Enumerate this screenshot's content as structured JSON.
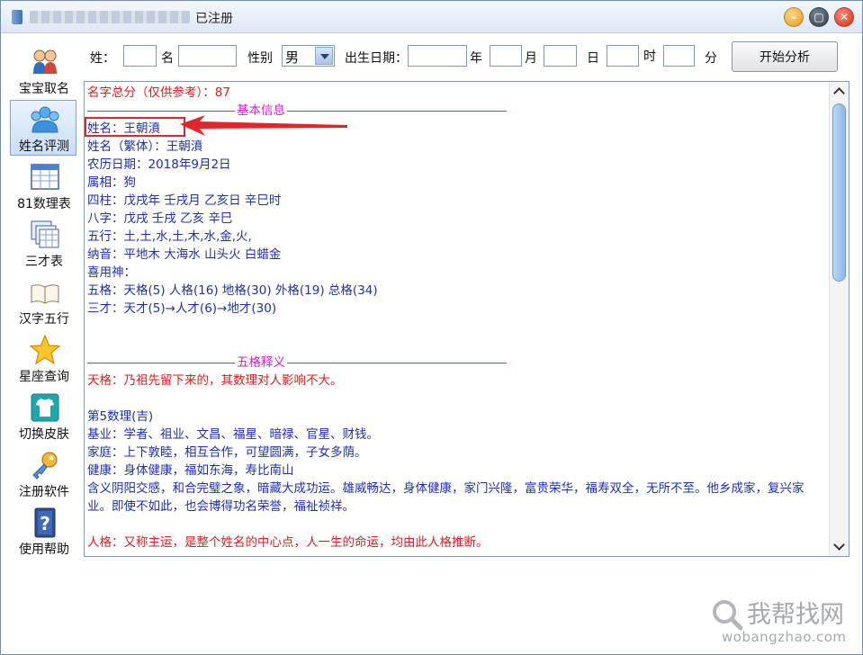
{
  "window": {
    "title": "已注册"
  },
  "sidebar": {
    "items": [
      {
        "label": "宝宝取名",
        "icon": "users-icon",
        "active": false
      },
      {
        "label": "姓名评测",
        "icon": "users-group-icon",
        "active": true
      },
      {
        "label": "81数理表",
        "icon": "table-icon",
        "active": false
      },
      {
        "label": "三才表",
        "icon": "table-stack-icon",
        "active": false
      },
      {
        "label": "汉字五行",
        "icon": "book-icon",
        "active": false
      },
      {
        "label": "星座查询",
        "icon": "star-icon",
        "active": false
      },
      {
        "label": "切换皮肤",
        "icon": "shirt-icon",
        "active": false
      },
      {
        "label": "注册软件",
        "icon": "key-icon",
        "active": false
      },
      {
        "label": "使用帮助",
        "icon": "help-book-icon",
        "active": false
      }
    ]
  },
  "form": {
    "surname_label": "姓：",
    "surname_value": "",
    "given_label": "名",
    "given_value": "",
    "gender_label": "性别",
    "gender_value": "男",
    "birth_label": "出生日期：",
    "year_value": "",
    "year_label": "年",
    "month_value": "",
    "month_label": "月",
    "day_value": "",
    "day_label": "日",
    "hour_value": "",
    "hour_label": "时",
    "minute_value": "",
    "minute_label": "分",
    "analyze_label": "开始分析"
  },
  "result": {
    "score": "名字总分（仅供参考）：87",
    "basic_title": "基本信息",
    "name": "姓名：王朝濆",
    "traditional": "姓名（繁体）：王朝濆",
    "lunar": "农历日期：2018年9月2日",
    "zodiac": "属相：狗",
    "sizhu": "四柱：戊戌年 壬戌月 乙亥日 辛巳时",
    "bazi": "八字：戊戌 壬戌 乙亥 辛巳",
    "wuxing": "五行：土,土,水,土,木,水,金,火,",
    "nayin": "纳音：平地木 大海水 山头火 白蜡金",
    "xiyong": "喜用神：",
    "wuge": "五格：天格(5) 人格(16) 地格(30) 外格(19) 总格(34)",
    "sancai": "三才：天才(5)→人才(6)→地才(30)",
    "wuge_title": "五格释义",
    "tiange": "天格：乃祖先留下来的，其数理对人影响不大。",
    "num5": "第5数理(吉)",
    "jiye": "基业：学者、祖业、文昌、福星、暗禄、官星、财钱。",
    "jiating": "家庭：上下敦睦，相互合作，可望圆满，子女多荫。",
    "jiankang": "健康：身体健康，福如东海，寿比南山",
    "hanyi": "含义阴阳交感，和合完璧之象，暗藏大成功运。雄威畅达，身体健康，家门兴隆，富贵荣华，福寿双全，无所不至。他乡成家，复兴家业。即使不如此，也会博得功名荣誉，福祉祯祥。",
    "renge": "人格：又称主运，是整个姓名的中心点，人一生的命运，均由此人格推断。"
  },
  "watermark": {
    "name": "我帮找网",
    "url": "wobangzhao.com"
  },
  "colors": {
    "blue_text": "#1d2fb5",
    "red_text": "#e41b1b",
    "magenta_text": "#d61ad2",
    "highlight_box": "#e0262b"
  }
}
